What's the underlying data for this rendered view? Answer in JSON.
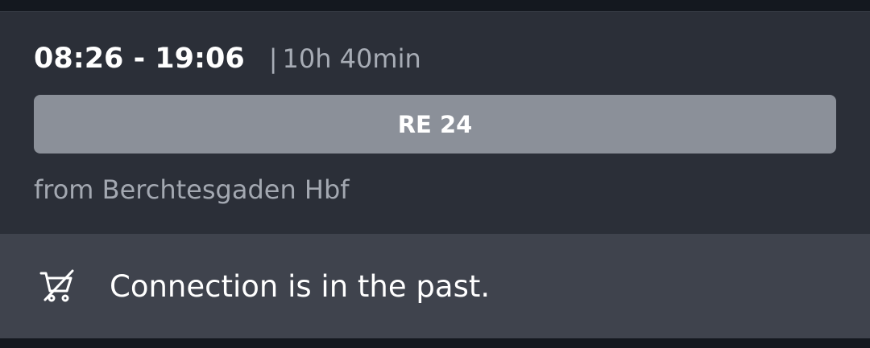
{
  "connection": {
    "times": "08:26 - 19:06",
    "duration_separator": "|",
    "duration": "10h 40min",
    "train": "RE 24",
    "origin": "from Berchtesgaden Hbf"
  },
  "notice": {
    "icon": "cart-unavailable-icon",
    "text": "Connection is in the past."
  },
  "colors": {
    "background": "#14181f",
    "card": "#2b2f38",
    "train_bar": "#8b9099",
    "notice_bar": "#3f434d",
    "text_primary": "#ffffff",
    "text_secondary": "#a7acb5"
  }
}
